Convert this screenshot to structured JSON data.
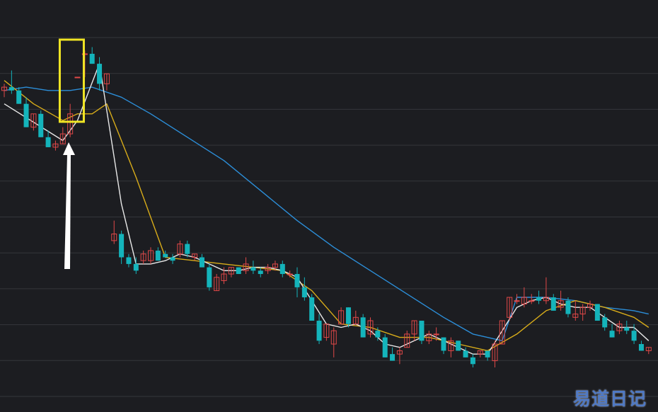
{
  "chart_data": {
    "type": "candlestick",
    "grid": true,
    "ylim": [
      0,
      115
    ],
    "colors": {
      "background": "#1c1d21",
      "grid": "#34363b",
      "up": "#e04848",
      "down": "#14b4bb",
      "ma_short": "#e8e8e8",
      "ma_mid": "#d8ac1a",
      "ma_long": "#2c8ed8",
      "highlight_box": "#f0e524",
      "arrow": "#ffffff"
    },
    "candles": [
      [
        90,
        92,
        88,
        91
      ],
      [
        91,
        96,
        89,
        90
      ],
      [
        90,
        91,
        86,
        86
      ],
      [
        86,
        88,
        79,
        79
      ],
      [
        79,
        83,
        78,
        83
      ],
      [
        83,
        84,
        76,
        76
      ],
      [
        76,
        78,
        73,
        73
      ],
      [
        73,
        75,
        72,
        74
      ],
      [
        74,
        79,
        74,
        77
      ],
      [
        77,
        86,
        76,
        83
      ],
      [
        94,
        94,
        94,
        94
      ],
      [
        101,
        102,
        94,
        101
      ],
      [
        101,
        103,
        98,
        98
      ],
      [
        98,
        100,
        90,
        92
      ],
      [
        92,
        95,
        90,
        95
      ],
      [
        45,
        51,
        44,
        47
      ],
      [
        47,
        48,
        38,
        40
      ],
      [
        40,
        41,
        37,
        38
      ],
      [
        38,
        40,
        35,
        36
      ],
      [
        39,
        42,
        38,
        41
      ],
      [
        39,
        43,
        38,
        42
      ],
      [
        42,
        43,
        39,
        39
      ],
      [
        41,
        42,
        40,
        40
      ],
      [
        40,
        41,
        38,
        39
      ],
      [
        41,
        45,
        40,
        44
      ],
      [
        44,
        45,
        40,
        41
      ],
      [
        40,
        41,
        39,
        41
      ],
      [
        40,
        41,
        37,
        37
      ],
      [
        37,
        38,
        30,
        31
      ],
      [
        30,
        35,
        30,
        34
      ],
      [
        33,
        37,
        32,
        35
      ],
      [
        35,
        37,
        34,
        37
      ],
      [
        37,
        37,
        35,
        35
      ],
      [
        36,
        40,
        35,
        38
      ],
      [
        37,
        39,
        35,
        36
      ],
      [
        36,
        37,
        34,
        35
      ],
      [
        36,
        38,
        35,
        37
      ],
      [
        37,
        39,
        36,
        38
      ],
      [
        38,
        39,
        34,
        35
      ],
      [
        35,
        36,
        34,
        35
      ],
      [
        35,
        37,
        28,
        31
      ],
      [
        31,
        34,
        27,
        28
      ],
      [
        28,
        29,
        21,
        21
      ],
      [
        21,
        23,
        14,
        15
      ],
      [
        16,
        20,
        15,
        20
      ],
      [
        14,
        19,
        10,
        18
      ],
      [
        20,
        25,
        20,
        24
      ],
      [
        25,
        25,
        19,
        20
      ],
      [
        20,
        24,
        20,
        22
      ],
      [
        22,
        23,
        16,
        16
      ],
      [
        17,
        22,
        16,
        21
      ],
      [
        18,
        19,
        15,
        16
      ],
      [
        16,
        17,
        10,
        10
      ],
      [
        11,
        13,
        9,
        9
      ],
      [
        11,
        13,
        8,
        12
      ],
      [
        13,
        18,
        13,
        17
      ],
      [
        17,
        21,
        15,
        21
      ],
      [
        21,
        21,
        14,
        15
      ],
      [
        15,
        18,
        14,
        17
      ],
      [
        17,
        19,
        15,
        17
      ],
      [
        16,
        16,
        11,
        12
      ],
      [
        12,
        16,
        10,
        15
      ],
      [
        15,
        15,
        12,
        12
      ],
      [
        12,
        13,
        10,
        10
      ],
      [
        10,
        11,
        7,
        8
      ],
      [
        11,
        12,
        10,
        12
      ],
      [
        12,
        12,
        9,
        10
      ],
      [
        9,
        15,
        7,
        14
      ],
      [
        14,
        21,
        14,
        21
      ],
      [
        22,
        28,
        21,
        28
      ],
      [
        27,
        29,
        26,
        27
      ],
      [
        26,
        31,
        25,
        28
      ],
      [
        27,
        29,
        26,
        27
      ],
      [
        28,
        30,
        26,
        27
      ],
      [
        27,
        34,
        26,
        28
      ],
      [
        28,
        29,
        24,
        24
      ],
      [
        25,
        30,
        24,
        27
      ],
      [
        27,
        28,
        22,
        23
      ],
      [
        22,
        27,
        21,
        23
      ],
      [
        23,
        26,
        21,
        25
      ],
      [
        25,
        27,
        24,
        26
      ],
      [
        26,
        26,
        21,
        21
      ],
      [
        22,
        23,
        18,
        19
      ],
      [
        18,
        20,
        16,
        16
      ],
      [
        18,
        21,
        17,
        20
      ],
      [
        19,
        21,
        17,
        18
      ],
      [
        18,
        20,
        14,
        15
      ],
      [
        14,
        15,
        12,
        12
      ],
      [
        12,
        13,
        11,
        13
      ]
    ],
    "ma_short": [
      [
        0,
        86
      ],
      [
        8,
        75
      ],
      [
        10,
        81
      ],
      [
        13,
        98
      ],
      [
        15,
        70
      ],
      [
        16,
        56
      ],
      [
        18,
        38
      ],
      [
        20,
        38
      ],
      [
        22,
        39
      ],
      [
        24,
        41
      ],
      [
        26,
        40
      ],
      [
        28,
        38
      ],
      [
        30,
        36
      ],
      [
        32,
        36
      ],
      [
        34,
        37
      ],
      [
        36,
        37
      ],
      [
        38,
        36
      ],
      [
        40,
        34
      ],
      [
        42,
        27
      ],
      [
        44,
        20
      ],
      [
        46,
        19
      ],
      [
        48,
        20
      ],
      [
        50,
        18
      ],
      [
        52,
        14
      ],
      [
        54,
        13
      ],
      [
        56,
        15
      ],
      [
        58,
        17
      ],
      [
        60,
        15
      ],
      [
        62,
        13
      ],
      [
        64,
        11
      ],
      [
        66,
        11
      ],
      [
        68,
        18
      ],
      [
        70,
        25
      ],
      [
        72,
        27
      ],
      [
        74,
        28
      ],
      [
        76,
        26
      ],
      [
        78,
        25
      ],
      [
        80,
        25
      ],
      [
        82,
        22
      ],
      [
        84,
        19
      ],
      [
        86,
        19
      ],
      [
        88,
        15
      ]
    ],
    "ma_mid": [
      [
        0,
        93
      ],
      [
        4,
        86
      ],
      [
        8,
        81
      ],
      [
        10,
        83
      ],
      [
        12,
        83
      ],
      [
        14,
        86
      ],
      [
        18,
        64
      ],
      [
        22,
        40
      ],
      [
        26,
        39
      ],
      [
        30,
        38
      ],
      [
        34,
        37
      ],
      [
        38,
        36
      ],
      [
        42,
        30
      ],
      [
        46,
        20
      ],
      [
        50,
        19
      ],
      [
        54,
        16
      ],
      [
        58,
        16
      ],
      [
        62,
        14
      ],
      [
        66,
        12
      ],
      [
        70,
        17
      ],
      [
        74,
        24
      ],
      [
        78,
        27
      ],
      [
        82,
        25
      ],
      [
        86,
        22
      ],
      [
        88,
        19
      ]
    ],
    "ma_long": [
      [
        0,
        90
      ],
      [
        3,
        91
      ],
      [
        6,
        90
      ],
      [
        9,
        90
      ],
      [
        12,
        91
      ],
      [
        16,
        88
      ],
      [
        20,
        83
      ],
      [
        25,
        76
      ],
      [
        30,
        69
      ],
      [
        35,
        60
      ],
      [
        40,
        51
      ],
      [
        45,
        43
      ],
      [
        50,
        36
      ],
      [
        55,
        29
      ],
      [
        60,
        22
      ],
      [
        64,
        17
      ],
      [
        68,
        15
      ],
      [
        70,
        28
      ],
      [
        74,
        28
      ],
      [
        78,
        27
      ],
      [
        82,
        25
      ],
      [
        86,
        24
      ],
      [
        88,
        23
      ]
    ]
  },
  "watermark": "易道日记"
}
